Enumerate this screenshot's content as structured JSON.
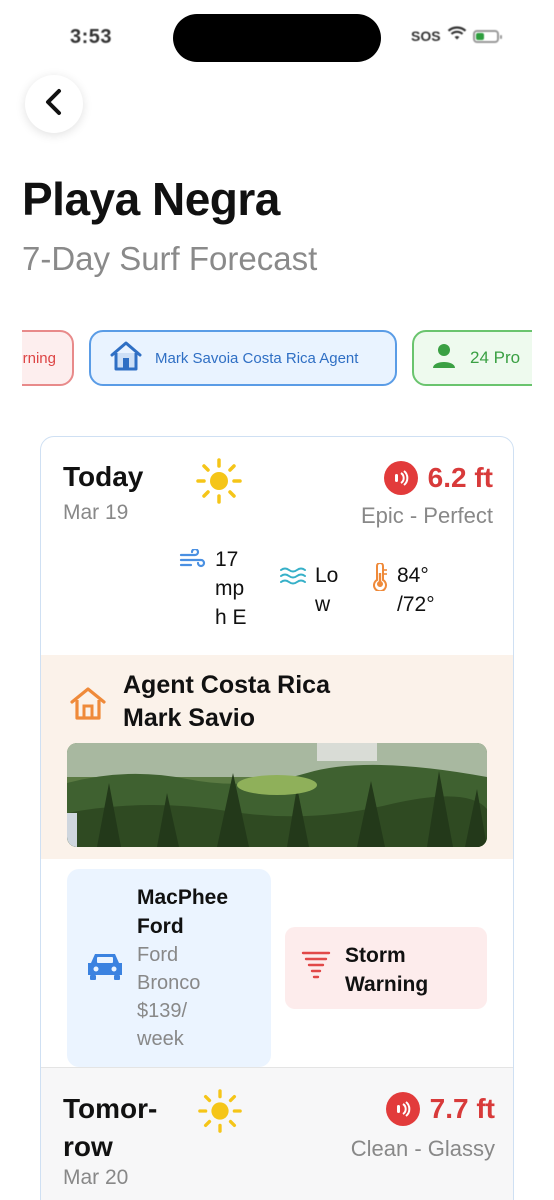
{
  "status_bar": {
    "time": "3:53",
    "sos": "SOS"
  },
  "header": {
    "title": "Playa Negra",
    "subtitle": "7-Day Surf Forecast"
  },
  "chips": [
    {
      "label": "rning",
      "color": "#d44444"
    },
    {
      "label": "Mark Savoia Costa Rica Agent",
      "icon": "home-icon",
      "color": "#2f6fc4"
    },
    {
      "label": "24 Pro",
      "icon": "person-icon",
      "color": "#3aa043"
    }
  ],
  "forecast": [
    {
      "day": "Today",
      "date": "Mar 19",
      "weather_icon": "sun-icon",
      "wave_height": "6.2 ft",
      "condition": "Epic - Perfect",
      "wind": [
        "17",
        "mp",
        "h E"
      ],
      "tide": [
        "Lo",
        "w"
      ],
      "temp": [
        "84°",
        "/72°"
      ],
      "agent": {
        "name_line1": "Agent Costa Rica",
        "name_line2": "Mark Savio"
      },
      "rental": {
        "name_line1": "MacPhee",
        "name_line2": "Ford",
        "desc": [
          "Ford",
          "Bronco",
          "$139/",
          "week"
        ]
      },
      "alert": {
        "line1": "Storm",
        "line2": "Warning"
      }
    },
    {
      "day_line1": "Tomor-",
      "day_line2": "row",
      "date": "Mar 20",
      "weather_icon": "sun-icon",
      "wave_height": "7.7 ft",
      "condition": "Clean - Glassy"
    }
  ],
  "colors": {
    "accent_red": "#d83a3a",
    "accent_blue": "#2f6fc4",
    "accent_green": "#3aa043",
    "accent_orange": "#ef8a3a"
  }
}
